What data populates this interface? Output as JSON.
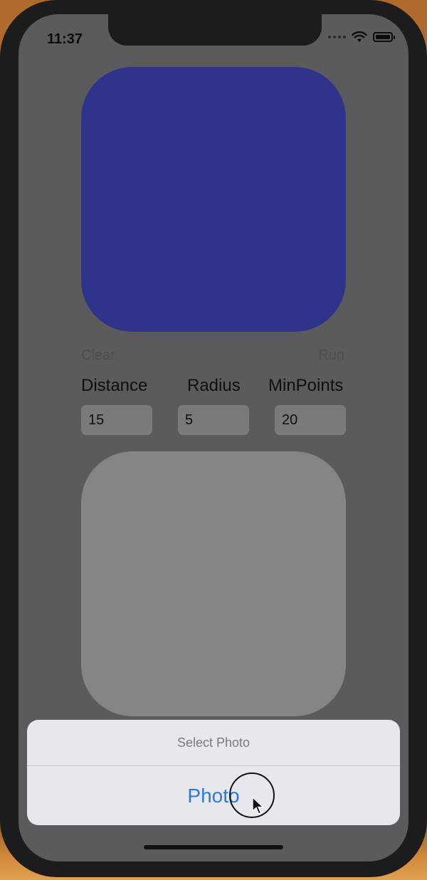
{
  "status_bar": {
    "time": "11:37"
  },
  "controls": {
    "clear_label": "Clear",
    "run_label": "Run"
  },
  "params": [
    {
      "label": "Distance",
      "value": "15"
    },
    {
      "label": "Radius",
      "value": "5"
    },
    {
      "label": "MinPoints",
      "value": "20"
    }
  ],
  "action_sheet": {
    "title": "Select Photo",
    "action_label": "Photo"
  },
  "colors": {
    "top_image": "#2f338a",
    "action_tint": "#2b7ad6"
  },
  "icons": [
    "wifi-icon",
    "battery-icon",
    "cellular-signal-icon",
    "pointer-cursor-icon"
  ]
}
